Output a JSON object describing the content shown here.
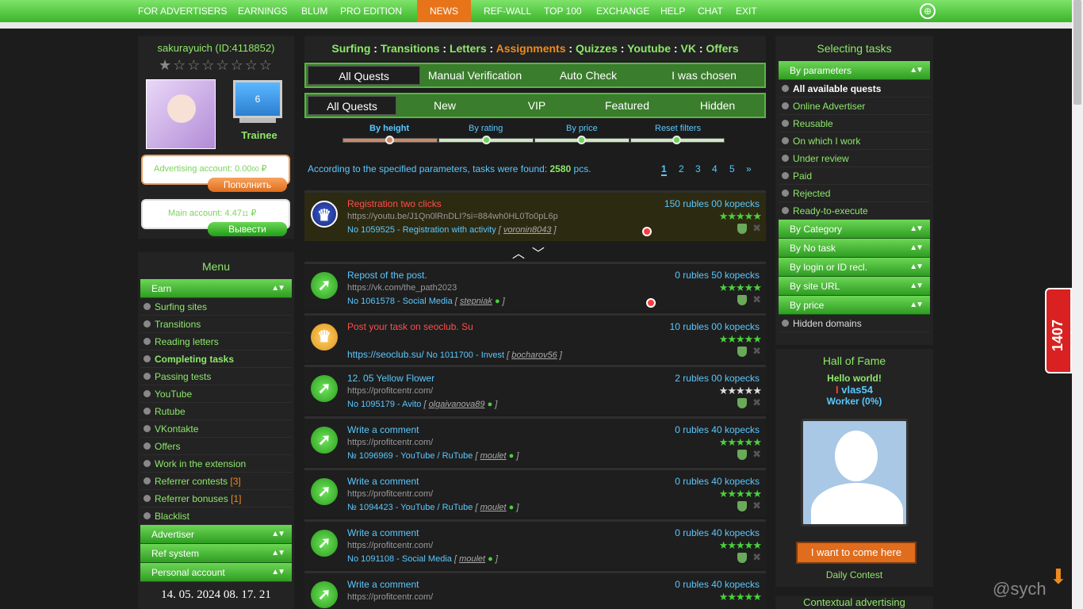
{
  "topnav": {
    "items": [
      "FOR ADVERTISERS",
      "EARNINGS",
      "BLUM",
      "PRO EDITION",
      "NEWS",
      "REF-WALL",
      "TOP 100",
      "EXCHANGE",
      "HELP",
      "CHAT",
      "EXIT"
    ]
  },
  "user": {
    "name": "sakurayuich (ID:4118852)",
    "level": "6",
    "rank": "Trainee",
    "adv_account": "Advertising account: 0.00",
    "adv_kop": "00",
    "adv_cur": "₽",
    "adv_btn": "Пополнить",
    "main_account": "Main account: 4.47",
    "main_kop": "11",
    "main_cur": "₽",
    "main_btn": "Вывести",
    "stars": "★☆☆☆☆☆☆☆"
  },
  "menu": {
    "title": "Menu",
    "earn": "Earn",
    "items": [
      {
        "label": "Surfing sites"
      },
      {
        "label": "Transitions"
      },
      {
        "label": "Reading letters"
      },
      {
        "label": "Completing tasks"
      },
      {
        "label": "Passing tests"
      },
      {
        "label": "YouTube"
      },
      {
        "label": "Rutube"
      },
      {
        "label": "VKontakte"
      },
      {
        "label": "Offers"
      },
      {
        "label": "Work in the extension"
      },
      {
        "label": "Referrer contests",
        "count": "[3]"
      },
      {
        "label": "Referrer bonuses",
        "count": "[1]"
      },
      {
        "label": "Blacklist"
      }
    ],
    "advertiser": "Advertiser",
    "ref": "Ref system",
    "personal": "Personal account",
    "datetime": "14. 05. 2024 08. 17. 21"
  },
  "header": {
    "surfing": "Surfing",
    "transitions": "Transitions",
    "letters": "Letters",
    "assignments": "Assignments",
    "quizzes": "Quizzes",
    "youtube": "Youtube",
    "vk": "VK",
    "offers": "Offers",
    "sep": " : "
  },
  "tabs1": [
    "All Quests",
    "Manual Verification",
    "Auto Check",
    "I was chosen"
  ],
  "tabs2": [
    "All Quests",
    "New",
    "VIP",
    "Featured",
    "Hidden"
  ],
  "filters": {
    "height": "By height",
    "rating": "By rating",
    "price": "By price",
    "reset": "Reset filters"
  },
  "found": {
    "text": "According to the specified parameters, tasks were found:",
    "count": "2580",
    "unit": "pcs."
  },
  "pages": [
    "1",
    "2",
    "3",
    "4",
    "5",
    "»"
  ],
  "tasks": [
    {
      "title": "Registration two clicks",
      "url": "https://youtu.be/J1Qn0lRnDLI?si=884wh0HL0To0pL6p",
      "meta": "No 1059525 - Registration with activity",
      "user": "voronin8043",
      "price": "150 rubles 00 kopecks",
      "stars": "★★★★★"
    },
    {
      "title": "Repost of the post.",
      "url": "https://vk.com/the_path2023",
      "meta": "No 1061578 - Social Media",
      "user": "stepniak",
      "price": "0 rubles 50 kopecks",
      "stars": "★★★★★"
    },
    {
      "title": "Post your task on seoclub. Su",
      "url": "https://seoclub.su/",
      "meta": "No 1011700 - Invest",
      "user": "bocharov56",
      "price": "10 rubles 00 kopecks",
      "stars": "★★★★★"
    },
    {
      "title": "12. 05 Yellow Flower",
      "url": "https://profitcentr.com/",
      "meta": "No 1095179 - Avito",
      "user": "olgaivanova89",
      "price": "2 rubles 00 kopecks",
      "stars": "★★★★★"
    },
    {
      "title": "Write a comment",
      "url": "https://profitcentr.com/",
      "meta": "№ 1096969 - YouTube / RuTube",
      "user": "moulet",
      "price": "0 rubles 40 kopecks",
      "stars": "★★★★★"
    },
    {
      "title": "Write a comment",
      "url": "https://profitcentr.com/",
      "meta": "№ 1094423 - YouTube / RuTube",
      "user": "moulet",
      "price": "0 rubles 40 kopecks",
      "stars": "★★★★★"
    },
    {
      "title": "Write a comment",
      "url": "https://profitcentr.com/",
      "meta": "No 1091108 - Social Media",
      "user": "moulet",
      "price": "0 rubles 40 kopecks",
      "stars": "★★★★★"
    },
    {
      "title": "Write a comment",
      "url": "https://profitcentr.com/",
      "meta": "",
      "user": "",
      "price": "0 rubles 40 kopecks",
      "stars": "★★★★★"
    }
  ],
  "right": {
    "title": "Selecting tasks",
    "by_params": "By parameters",
    "items": [
      "All available quests",
      "Online Advertiser",
      "Reusable",
      "On which I work",
      "Under review",
      "Paid",
      "Rejected",
      "Ready-to-execute"
    ],
    "cats": [
      "By Category",
      "By No task",
      "By login or ID recl.",
      "By site URL",
      "By price"
    ],
    "hidden": "Hidden domains",
    "hof": "Hall of Fame",
    "hello": "Hello world!",
    "hof_user": "vlas54",
    "hof_worker": "Worker (0%)",
    "hof_btn": "I want to come here",
    "daily": "Daily Contest",
    "ctx": "Contextual advertising"
  },
  "side_tab": "1407",
  "watermark": "@sych"
}
